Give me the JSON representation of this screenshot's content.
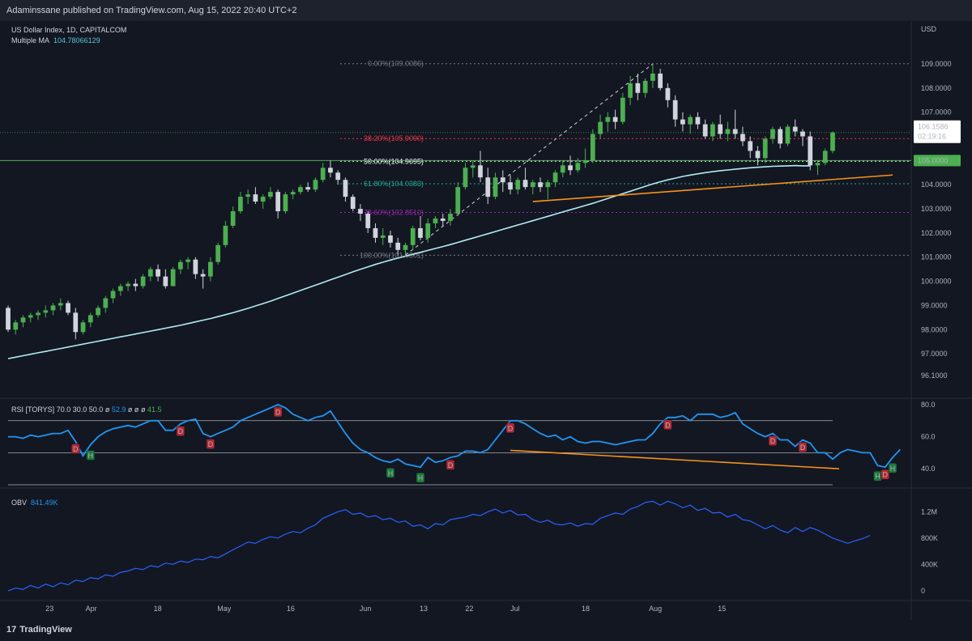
{
  "header": {
    "published": "Adaminssane published on TradingView.com, Aug 15, 2022 20:40 UTC+2"
  },
  "main_legend": {
    "symbol": "US Dollar Index, 1D, CAPITALCOM",
    "ma_label": "Multiple MA",
    "ma_value": "104.78066129"
  },
  "rsi_legend": {
    "label": "RSI [TORYS]",
    "p1": "70.0",
    "p2": "30.0",
    "p3": "50.0",
    "p4": "ø",
    "p5": "ø",
    "p6": "ø",
    "p7": "ø",
    "val1": "52.9",
    "val2": "41.5"
  },
  "obv_legend": {
    "label": "OBV",
    "value": "841.49K"
  },
  "footer": {
    "brand": "TradingView"
  },
  "colors": {
    "background": "#131722",
    "up": "#4caf50",
    "down": "#d1d4dc",
    "ma": "#b2ebf2",
    "rsi": "#2196f3",
    "obv": "#2962ff",
    "trend": "#f7931a",
    "horizontal": "#4caf50"
  },
  "chart_data": [
    {
      "type": "candlestick",
      "title": "US Dollar Index, 1D, CAPITALCOM",
      "ylabel": "USD",
      "ylim": [
        96.1,
        109.3
      ],
      "y_ticks": [
        "109.0000",
        "108.0000",
        "107.0000",
        "106.0000",
        "105.0000",
        "104.0000",
        "103.0000",
        "102.0000",
        "101.0000",
        "100.0000",
        "99.0000",
        "98.0000",
        "97.0000",
        "96.1000"
      ],
      "x_ticks": [
        "23",
        "Apr",
        "18",
        "May",
        "16",
        "Jun",
        "13",
        "22",
        "Jul",
        "18",
        "Aug",
        "15"
      ],
      "price_label": "106.1586",
      "countdown": "02:19:16",
      "level_label": "105.0000",
      "fib_levels": [
        {
          "label": "0.00%(109.0086)",
          "value": 109.0086,
          "color": "#787b86"
        },
        {
          "label": "38.20%(105.9090)",
          "value": 105.909,
          "color": "#f23645"
        },
        {
          "label": "50.00%(104.9695)",
          "value": 104.9695,
          "color": "#ffffff"
        },
        {
          "label": "61.80%(104.0383)",
          "value": 104.0383,
          "color": "#22ab94"
        },
        {
          "label": "78.60%(102.8510)",
          "value": 102.851,
          "color": "#9c27b0"
        },
        {
          "label": "100.00%(101.0801)",
          "value": 101.0801,
          "color": "#787b86"
        }
      ],
      "candles": [
        [
          98.9,
          99.0,
          97.9,
          98.0
        ],
        [
          98.0,
          98.4,
          97.8,
          98.3
        ],
        [
          98.3,
          98.6,
          98.1,
          98.5
        ],
        [
          98.5,
          98.7,
          98.3,
          98.6
        ],
        [
          98.6,
          98.8,
          98.4,
          98.7
        ],
        [
          98.7,
          99.0,
          98.5,
          98.8
        ],
        [
          98.8,
          99.1,
          98.6,
          99.0
        ],
        [
          99.0,
          99.3,
          98.8,
          99.1
        ],
        [
          99.1,
          99.2,
          98.6,
          98.7
        ],
        [
          98.7,
          98.9,
          97.6,
          97.9
        ],
        [
          97.9,
          98.4,
          97.8,
          98.3
        ],
        [
          98.3,
          98.7,
          98.1,
          98.6
        ],
        [
          98.6,
          99.0,
          98.5,
          98.9
        ],
        [
          98.9,
          99.4,
          98.7,
          99.3
        ],
        [
          99.3,
          99.7,
          99.1,
          99.6
        ],
        [
          99.6,
          99.9,
          99.4,
          99.8
        ],
        [
          99.8,
          100.0,
          99.6,
          99.9
        ],
        [
          99.9,
          100.1,
          99.6,
          99.8
        ],
        [
          99.8,
          100.3,
          99.7,
          100.2
        ],
        [
          100.2,
          100.6,
          100.0,
          100.5
        ],
        [
          100.5,
          100.7,
          100.0,
          100.2
        ],
        [
          100.2,
          100.5,
          99.7,
          99.8
        ],
        [
          99.8,
          100.6,
          99.8,
          100.5
        ],
        [
          100.5,
          100.9,
          100.3,
          100.8
        ],
        [
          100.8,
          101.0,
          100.5,
          100.9
        ],
        [
          100.9,
          101.0,
          100.1,
          100.3
        ],
        [
          100.3,
          100.5,
          99.7,
          100.2
        ],
        [
          100.2,
          101.0,
          100.0,
          100.8
        ],
        [
          100.8,
          101.6,
          100.7,
          101.5
        ],
        [
          101.5,
          102.5,
          101.4,
          102.3
        ],
        [
          102.3,
          103.1,
          102.2,
          102.9
        ],
        [
          102.9,
          103.7,
          102.8,
          103.5
        ],
        [
          103.5,
          103.8,
          103.2,
          103.6
        ],
        [
          103.6,
          103.9,
          103.2,
          103.3
        ],
        [
          103.3,
          103.6,
          103.0,
          103.5
        ],
        [
          103.5,
          103.9,
          103.4,
          103.7
        ],
        [
          103.7,
          103.8,
          102.6,
          102.9
        ],
        [
          102.9,
          103.7,
          102.8,
          103.6
        ],
        [
          103.6,
          103.8,
          103.4,
          103.7
        ],
        [
          103.7,
          104.0,
          103.6,
          103.9
        ],
        [
          103.9,
          104.1,
          103.7,
          103.8
        ],
        [
          103.8,
          104.3,
          103.7,
          104.2
        ],
        [
          104.2,
          104.9,
          104.1,
          104.7
        ],
        [
          104.7,
          105.0,
          104.3,
          104.5
        ],
        [
          104.5,
          104.6,
          104.0,
          104.2
        ],
        [
          104.2,
          104.3,
          103.3,
          103.5
        ],
        [
          103.5,
          103.6,
          102.9,
          103.0
        ],
        [
          103.0,
          103.2,
          102.5,
          102.8
        ],
        [
          102.8,
          102.9,
          102.0,
          102.2
        ],
        [
          102.2,
          102.4,
          101.6,
          101.8
        ],
        [
          101.8,
          102.2,
          101.5,
          101.9
        ],
        [
          101.9,
          102.1,
          101.4,
          101.6
        ],
        [
          101.6,
          101.8,
          101.1,
          101.3
        ],
        [
          101.3,
          101.6,
          101.0,
          101.5
        ],
        [
          101.5,
          102.3,
          101.3,
          102.2
        ],
        [
          102.2,
          102.7,
          101.7,
          101.8
        ],
        [
          101.8,
          102.6,
          101.6,
          102.4
        ],
        [
          102.4,
          102.7,
          102.2,
          102.6
        ],
        [
          102.6,
          102.8,
          102.3,
          102.5
        ],
        [
          102.5,
          103.0,
          102.3,
          102.8
        ],
        [
          102.8,
          104.1,
          102.7,
          103.9
        ],
        [
          103.9,
          104.9,
          103.8,
          104.7
        ],
        [
          104.7,
          105.0,
          104.3,
          104.8
        ],
        [
          104.8,
          105.4,
          104.1,
          104.3
        ],
        [
          104.3,
          104.7,
          103.2,
          103.5
        ],
        [
          103.5,
          104.5,
          103.4,
          104.3
        ],
        [
          104.3,
          104.6,
          103.7,
          104.1
        ],
        [
          104.1,
          104.4,
          103.6,
          103.8
        ],
        [
          103.8,
          104.3,
          103.6,
          104.2
        ],
        [
          104.2,
          104.7,
          103.8,
          103.9
        ],
        [
          103.9,
          104.2,
          103.6,
          104.1
        ],
        [
          104.1,
          104.3,
          103.7,
          103.9
        ],
        [
          103.9,
          104.2,
          103.4,
          104.1
        ],
        [
          104.1,
          104.6,
          103.9,
          104.5
        ],
        [
          104.5,
          105.0,
          104.3,
          104.8
        ],
        [
          104.8,
          105.2,
          104.4,
          104.6
        ],
        [
          104.6,
          105.1,
          104.5,
          104.9
        ],
        [
          104.9,
          105.5,
          104.7,
          105.0
        ],
        [
          105.0,
          106.3,
          104.9,
          106.1
        ],
        [
          106.1,
          106.9,
          105.9,
          106.6
        ],
        [
          106.6,
          107.0,
          106.2,
          106.8
        ],
        [
          106.8,
          107.1,
          106.3,
          106.6
        ],
        [
          106.6,
          107.8,
          106.5,
          107.6
        ],
        [
          107.6,
          108.5,
          107.3,
          108.2
        ],
        [
          108.2,
          108.6,
          107.5,
          107.8
        ],
        [
          107.8,
          108.4,
          107.6,
          108.3
        ],
        [
          108.3,
          109.0,
          108.0,
          108.6
        ],
        [
          108.6,
          108.8,
          107.9,
          108.0
        ],
        [
          108.0,
          108.2,
          107.2,
          107.5
        ],
        [
          107.5,
          107.7,
          106.4,
          106.7
        ],
        [
          106.7,
          107.0,
          106.2,
          106.5
        ],
        [
          106.5,
          106.9,
          106.1,
          106.8
        ],
        [
          106.8,
          107.0,
          106.3,
          106.5
        ],
        [
          106.5,
          106.7,
          105.9,
          106.0
        ],
        [
          106.0,
          106.6,
          105.8,
          106.5
        ],
        [
          106.5,
          106.9,
          105.9,
          106.1
        ],
        [
          106.1,
          106.6,
          105.8,
          106.3
        ],
        [
          106.3,
          107.1,
          105.9,
          106.1
        ],
        [
          106.1,
          106.4,
          105.6,
          105.8
        ],
        [
          105.8,
          106.0,
          105.1,
          105.4
        ],
        [
          105.4,
          105.6,
          104.8,
          105.1
        ],
        [
          105.1,
          106.0,
          104.9,
          105.9
        ],
        [
          105.9,
          106.4,
          105.7,
          106.3
        ],
        [
          106.3,
          106.4,
          105.5,
          105.7
        ],
        [
          105.7,
          106.5,
          105.6,
          106.4
        ],
        [
          106.4,
          106.7,
          106.0,
          106.2
        ],
        [
          106.2,
          106.3,
          105.6,
          106.0
        ],
        [
          106.0,
          106.2,
          104.6,
          104.8
        ],
        [
          104.8,
          105.0,
          104.4,
          104.9
        ],
        [
          104.9,
          105.5,
          104.8,
          105.4
        ],
        [
          105.4,
          106.2,
          105.3,
          106.16
        ]
      ],
      "ma": [
        96.8,
        96.86,
        96.92,
        96.98,
        97.04,
        97.1,
        97.16,
        97.22,
        97.28,
        97.34,
        97.4,
        97.46,
        97.52,
        97.58,
        97.64,
        97.7,
        97.76,
        97.82,
        97.88,
        97.94,
        98.0,
        98.06,
        98.12,
        98.18,
        98.25,
        98.32,
        98.39,
        98.46,
        98.54,
        98.62,
        98.7,
        98.79,
        98.88,
        98.98,
        99.08,
        99.18,
        99.29,
        99.4,
        99.51,
        99.62,
        99.73,
        99.84,
        99.95,
        100.06,
        100.17,
        100.28,
        100.39,
        100.5,
        100.6,
        100.7,
        100.79,
        100.88,
        100.96,
        101.04,
        101.12,
        101.2,
        101.28,
        101.36,
        101.44,
        101.52,
        101.61,
        101.7,
        101.79,
        101.88,
        101.97,
        102.06,
        102.15,
        102.24,
        102.33,
        102.42,
        102.51,
        102.6,
        102.69,
        102.78,
        102.87,
        102.96,
        103.05,
        103.14,
        103.23,
        103.33,
        103.43,
        103.53,
        103.63,
        103.73,
        103.83,
        103.93,
        104.03,
        104.12,
        104.2,
        104.27,
        104.34,
        104.4,
        104.45,
        104.5,
        104.54,
        104.58,
        104.61,
        104.64,
        104.67,
        104.7,
        104.72,
        104.74,
        104.76,
        104.77,
        104.78,
        104.79,
        104.78,
        104.78
      ]
    },
    {
      "type": "line",
      "title": "RSI [TORYS]",
      "ylim": [
        30,
        82
      ],
      "y_ticks": [
        "80.0",
        "60.0",
        "40.0"
      ],
      "levels": [
        70,
        50,
        30
      ],
      "values": [
        60,
        60,
        59,
        61,
        60,
        61,
        62,
        62,
        64,
        57,
        48,
        55,
        60,
        63,
        65,
        66,
        67,
        66,
        68,
        70,
        70,
        64,
        64,
        68,
        70,
        71,
        62,
        60,
        62,
        64,
        66,
        70,
        72,
        74,
        76,
        78,
        80,
        78,
        74,
        72,
        70,
        72,
        73,
        76,
        69,
        62,
        56,
        52,
        50,
        47,
        45,
        44,
        46,
        43,
        42,
        41,
        47,
        44,
        45,
        47,
        48,
        51,
        51,
        50,
        52,
        58,
        64,
        70,
        70,
        68,
        65,
        62,
        60,
        61,
        58,
        60,
        57,
        56,
        57,
        57,
        56,
        55,
        56,
        57,
        58,
        58,
        62,
        68,
        72,
        72,
        73,
        70,
        74,
        74,
        74,
        72,
        73,
        75,
        68,
        65,
        62,
        60,
        62,
        58,
        58,
        54,
        58,
        56,
        50,
        50,
        46,
        50,
        52,
        51,
        50,
        50,
        42,
        41,
        47,
        52
      ],
      "markers": [
        {
          "i": 9,
          "label": "D"
        },
        {
          "i": 11,
          "label": "H"
        },
        {
          "i": 23,
          "label": "D"
        },
        {
          "i": 27,
          "label": "D"
        },
        {
          "i": 36,
          "label": "D"
        },
        {
          "i": 51,
          "label": "H"
        },
        {
          "i": 55,
          "label": "H"
        },
        {
          "i": 59,
          "label": "D"
        },
        {
          "i": 67,
          "label": "D"
        },
        {
          "i": 88,
          "label": "D"
        },
        {
          "i": 102,
          "label": "D"
        },
        {
          "i": 106,
          "label": "D"
        },
        {
          "i": 116,
          "label": "H"
        },
        {
          "i": 117,
          "label": "D"
        },
        {
          "i": 118,
          "label": "H"
        }
      ]
    },
    {
      "type": "line",
      "title": "OBV",
      "ylim": [
        -100,
        1400
      ],
      "y_ticks": [
        "1.2M",
        "800K",
        "400K",
        "0"
      ],
      "y_tick_values": [
        1200,
        800,
        400,
        0
      ],
      "values": [
        0,
        40,
        20,
        80,
        40,
        100,
        60,
        120,
        90,
        160,
        140,
        200,
        180,
        240,
        220,
        280,
        300,
        340,
        320,
        380,
        360,
        420,
        400,
        450,
        430,
        480,
        470,
        520,
        500,
        560,
        620,
        680,
        740,
        720,
        780,
        820,
        800,
        860,
        900,
        880,
        950,
        1000,
        1100,
        1150,
        1200,
        1230,
        1160,
        1180,
        1120,
        1140,
        1080,
        1100,
        1040,
        1060,
        980,
        1000,
        940,
        1020,
        1000,
        1080,
        1100,
        1120,
        1160,
        1140,
        1200,
        1240,
        1180,
        1220,
        1150,
        1160,
        1080,
        1040,
        1070,
        1010,
        1000,
        1030,
        980,
        1020,
        1010,
        1100,
        1140,
        1180,
        1160,
        1240,
        1280,
        1340,
        1360,
        1300,
        1360,
        1320,
        1260,
        1300,
        1220,
        1250,
        1180,
        1190,
        1120,
        1160,
        1080,
        1060,
        1000,
        940,
        990,
        920,
        880,
        960,
        900,
        960,
        920,
        860,
        800,
        760,
        720,
        760,
        790,
        840
      ]
    }
  ]
}
